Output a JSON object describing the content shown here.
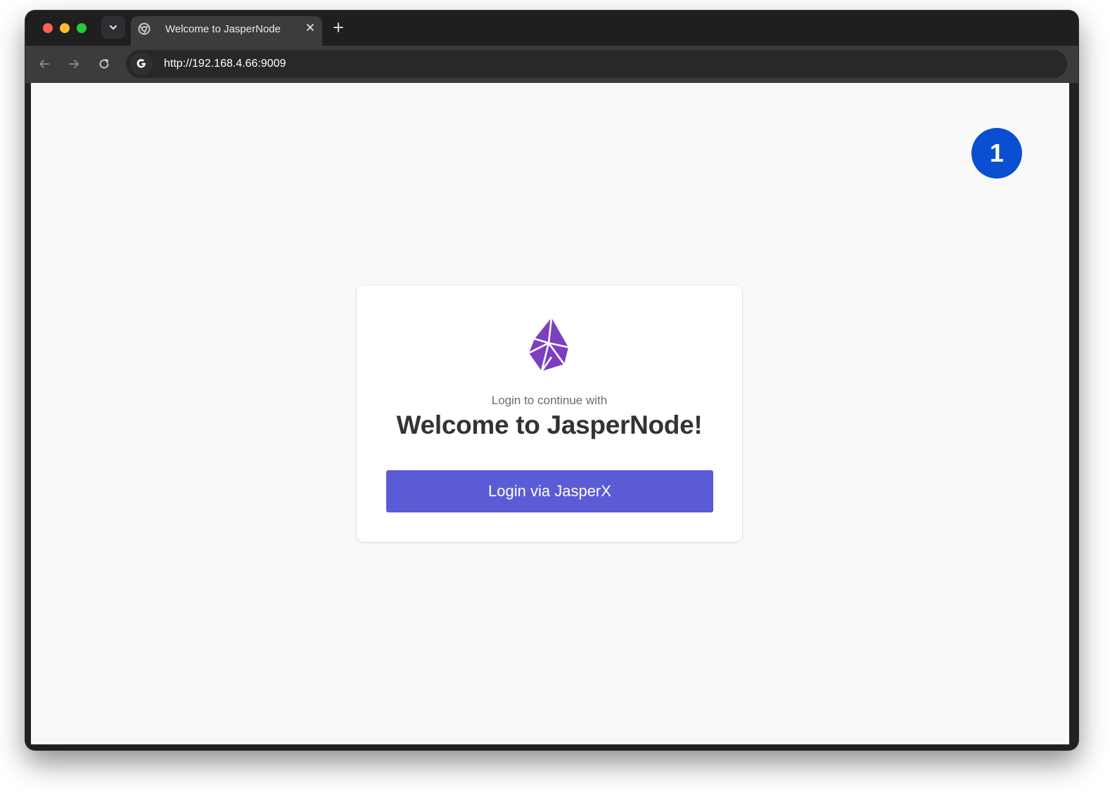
{
  "browser": {
    "tab": {
      "title": "Welcome to JasperNode",
      "favicon": "chrome-favicon-icon"
    },
    "new_tab_icon": "plus-icon",
    "close_tab_icon": "close-icon",
    "address_bar": {
      "url": "http://192.168.4.66:9009",
      "site_icon": "google-g-icon"
    },
    "nav_icons": [
      "back-arrow-icon",
      "forward-arrow-icon",
      "reload-icon"
    ]
  },
  "annotation": {
    "step_number": "1",
    "color": "#0a4fd1"
  },
  "login_card": {
    "logo": "jaspernode-crystal-logo",
    "subtitle": "Login to continue with",
    "title": "Welcome to JasperNode!",
    "login_button_label": "Login via JasperX",
    "button_color": "#5b5bd6",
    "logo_color": "#7b3fbf"
  }
}
